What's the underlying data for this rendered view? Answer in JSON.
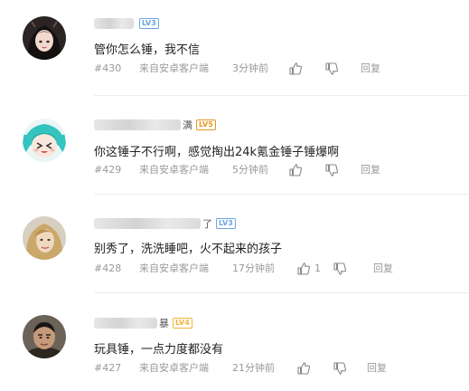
{
  "comments": [
    {
      "floor": "#430",
      "source": "来自安卓客户端",
      "time": "3分钟前",
      "text": "管你怎么锤，我不信",
      "name_suffix": "",
      "level": "LV3",
      "level_color": "#6aa5e3",
      "likes": "",
      "reply_label": "回复",
      "avatar_icon": "dark-haired-girl-avatar"
    },
    {
      "floor": "#429",
      "source": "来自安卓客户端",
      "time": "5分钟前",
      "text": "你这锤子不行啊，感觉掏出24k氪金锤子锤爆啊",
      "name_suffix": "满",
      "level": "LV5",
      "level_color": "#e8961e",
      "likes": "",
      "reply_label": "回复",
      "avatar_icon": "teal-haired-anime-avatar"
    },
    {
      "floor": "#428",
      "source": "来自安卓客户端",
      "time": "17分钟前",
      "text": "别秀了，洗洗睡吧，火不起来的孩子",
      "name_suffix": "了",
      "level": "LV3",
      "level_color": "#6aa5e3",
      "likes": "1",
      "reply_label": "回复",
      "avatar_icon": "blonde-woman-avatar"
    },
    {
      "floor": "#427",
      "source": "来自安卓客户端",
      "time": "21分钟前",
      "text": "玩具锤，一点力度都没有",
      "name_suffix": "暴",
      "level": "LV4",
      "level_color": "#f0b43c",
      "likes": "",
      "reply_label": "回复",
      "avatar_icon": "man-portrait-avatar"
    }
  ],
  "colors": {
    "meta_text": "#999999",
    "body_text": "#222222",
    "divider": "#ececec"
  },
  "icons": {
    "like": "thumbs-up-icon",
    "dislike": "thumbs-down-icon"
  }
}
